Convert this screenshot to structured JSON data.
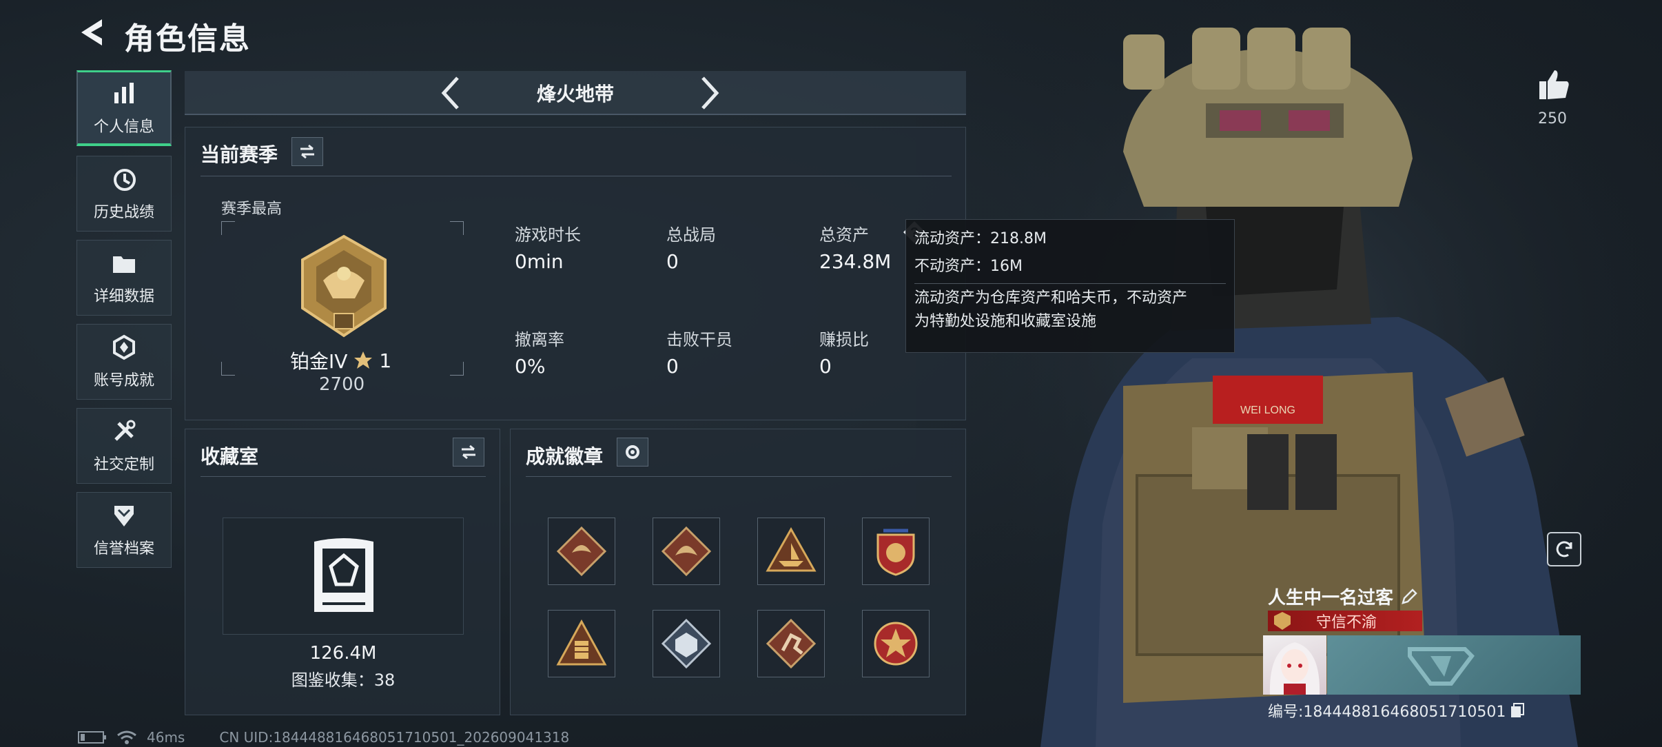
{
  "header": {
    "title": "角色信息"
  },
  "nav": {
    "items": [
      {
        "label": "个人信息",
        "icon": "bar-chart-icon",
        "active": true
      },
      {
        "label": "历史战绩",
        "icon": "clock-history-icon",
        "active": false
      },
      {
        "label": "详细数据",
        "icon": "folder-icon",
        "active": false
      },
      {
        "label": "账号成就",
        "icon": "achievement-icon",
        "active": false
      },
      {
        "label": "社交定制",
        "icon": "tools-icon",
        "active": false
      },
      {
        "label": "信誉档案",
        "icon": "shield-rank-icon",
        "active": false
      }
    ]
  },
  "mode": {
    "title": "烽火地带"
  },
  "season": {
    "title": "当前赛季",
    "best_label": "赛季最高",
    "rank": "铂金IV",
    "stars": "1",
    "score": "2700",
    "stats": [
      {
        "label": "游戏时长",
        "value": "0min"
      },
      {
        "label": "总战局",
        "value": "0"
      },
      {
        "label": "总资产",
        "value": "234.8M"
      },
      {
        "label": "撤离率",
        "value": "0%"
      },
      {
        "label": "击败干员",
        "value": "0"
      },
      {
        "label": "赚损比",
        "value": "0"
      }
    ]
  },
  "tooltip": {
    "liquid": "流动资产：218.8M",
    "fixed": "不动资产：16M",
    "note_line1": "流动资产为仓库资产和哈夫币，不动资产",
    "note_line2": "为特勤处设施和收藏室设施"
  },
  "collection": {
    "title": "收藏室",
    "value": "126.4M",
    "catalog": "图鉴收集：38"
  },
  "badges": {
    "title": "成就徽章",
    "icons": [
      "dragon-badge-icon",
      "dragon-badge-icon",
      "ship-badge-icon",
      "emblem-badge-icon",
      "pyramid-badge-icon",
      "cube-badge-icon",
      "runner-badge-icon",
      "star-emblem-badge-icon"
    ]
  },
  "status_bar": {
    "ping": "46ms",
    "uid": "CN UID:18444881646805171050​1_202609041318"
  },
  "profile": {
    "likes": "250",
    "name": "人生中一名过客",
    "honor": "守信不渝",
    "id": "编号:18444881646805171050​1"
  },
  "colors": {
    "accent": "#3fd08a",
    "panel": "#222c35",
    "honor_red": "#b22020"
  }
}
